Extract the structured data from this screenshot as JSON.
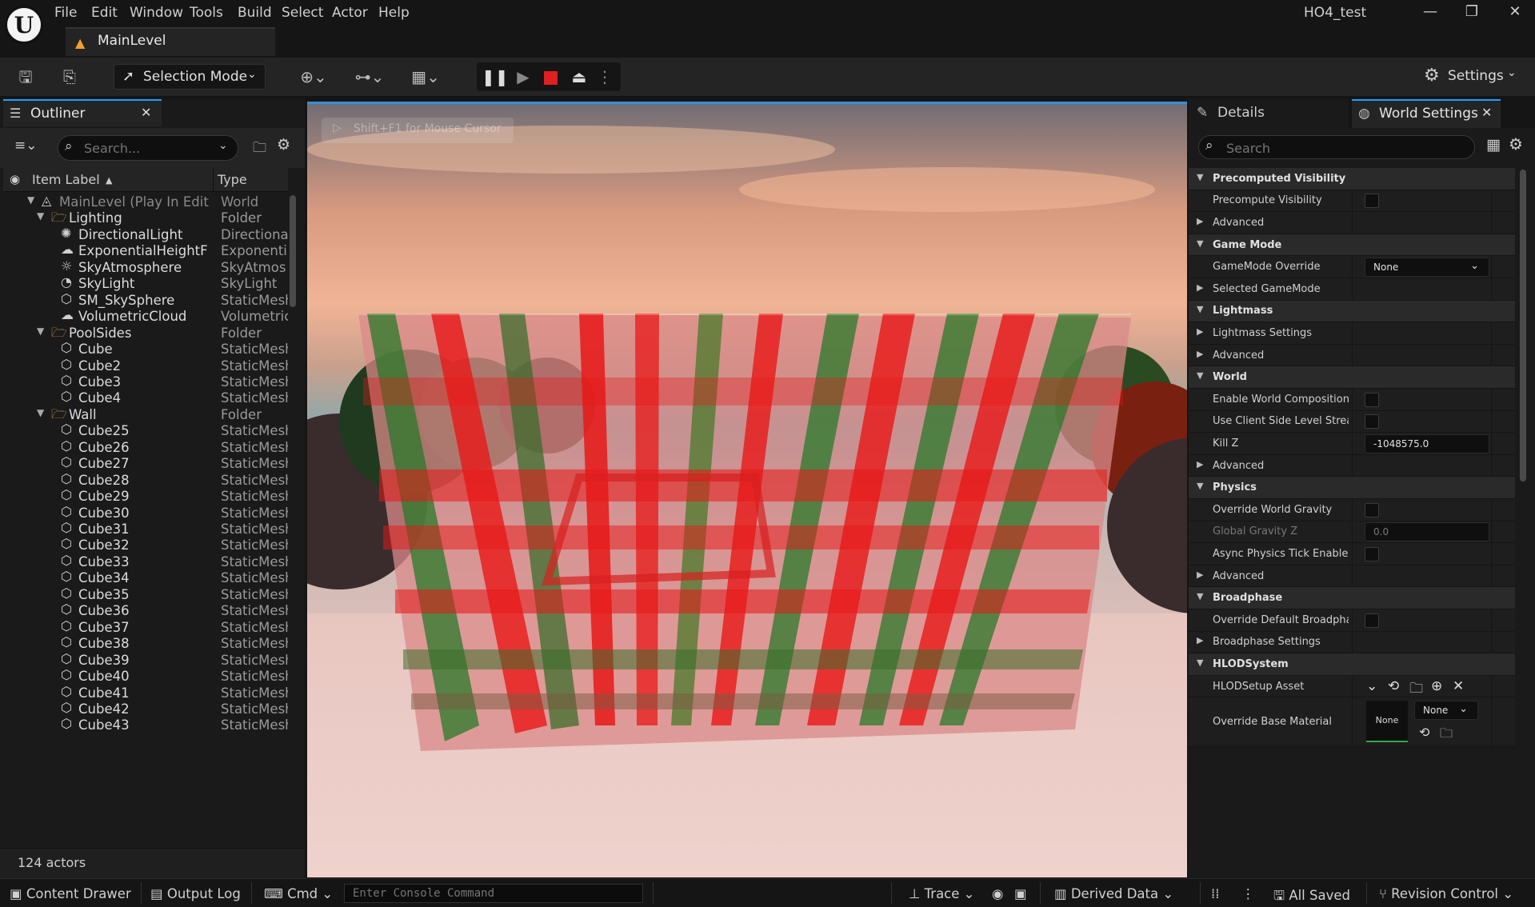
{
  "app": {
    "project_name": "HO4_test",
    "logo_glyph": "U"
  },
  "menu": [
    "File",
    "Edit",
    "Window",
    "Tools",
    "Build",
    "Select",
    "Actor",
    "Help"
  ],
  "document_tab": {
    "label": "MainLevel"
  },
  "window_controls": {
    "minimize": "—",
    "restore": "❐",
    "close": "✕"
  },
  "toolbar": {
    "mode_label": "Selection Mode",
    "settings_label": "Settings"
  },
  "outliner": {
    "tab_label": "Outliner",
    "search_placeholder": "Search...",
    "col_label": "Item Label",
    "col_type": "Type",
    "footer": "124 actors",
    "rows": [
      {
        "indent": 0,
        "arrow": "▼",
        "icon": "level",
        "label": "MainLevel (Play In Edit",
        "type": "World",
        "dim": true
      },
      {
        "indent": 1,
        "arrow": "▼",
        "icon": "folder",
        "label": "Lighting",
        "type": "Folder"
      },
      {
        "indent": 2,
        "icon": "light",
        "label": "DirectionalLight",
        "type": "Directional"
      },
      {
        "indent": 2,
        "icon": "fog",
        "label": "ExponentialHeightF",
        "type": "Exponentia"
      },
      {
        "indent": 2,
        "icon": "sky",
        "label": "SkyAtmosphere",
        "type": "SkyAtmos"
      },
      {
        "indent": 2,
        "icon": "skylight",
        "label": "SkyLight",
        "type": "SkyLight"
      },
      {
        "indent": 2,
        "icon": "mesh",
        "label": "SM_SkySphere",
        "type": "StaticMesh"
      },
      {
        "indent": 2,
        "icon": "cloud",
        "label": "VolumetricCloud",
        "type": "Volumetric"
      },
      {
        "indent": 1,
        "arrow": "▼",
        "icon": "folder",
        "label": "PoolSides",
        "type": "Folder"
      },
      {
        "indent": 2,
        "icon": "mesh",
        "label": "Cube",
        "type": "StaticMesh"
      },
      {
        "indent": 2,
        "icon": "mesh",
        "label": "Cube2",
        "type": "StaticMesh"
      },
      {
        "indent": 2,
        "icon": "mesh",
        "label": "Cube3",
        "type": "StaticMesh"
      },
      {
        "indent": 2,
        "icon": "mesh",
        "label": "Cube4",
        "type": "StaticMesh"
      },
      {
        "indent": 1,
        "arrow": "▼",
        "icon": "folder",
        "label": "Wall",
        "type": "Folder"
      },
      {
        "indent": 2,
        "icon": "mesh",
        "label": "Cube25",
        "type": "StaticMesh"
      },
      {
        "indent": 2,
        "icon": "mesh",
        "label": "Cube26",
        "type": "StaticMesh"
      },
      {
        "indent": 2,
        "icon": "mesh",
        "label": "Cube27",
        "type": "StaticMesh"
      },
      {
        "indent": 2,
        "icon": "mesh",
        "label": "Cube28",
        "type": "StaticMesh"
      },
      {
        "indent": 2,
        "icon": "mesh",
        "label": "Cube29",
        "type": "StaticMesh"
      },
      {
        "indent": 2,
        "icon": "mesh",
        "label": "Cube30",
        "type": "StaticMesh"
      },
      {
        "indent": 2,
        "icon": "mesh",
        "label": "Cube31",
        "type": "StaticMesh"
      },
      {
        "indent": 2,
        "icon": "mesh",
        "label": "Cube32",
        "type": "StaticMesh"
      },
      {
        "indent": 2,
        "icon": "mesh",
        "label": "Cube33",
        "type": "StaticMesh"
      },
      {
        "indent": 2,
        "icon": "mesh",
        "label": "Cube34",
        "type": "StaticMesh"
      },
      {
        "indent": 2,
        "icon": "mesh",
        "label": "Cube35",
        "type": "StaticMesh"
      },
      {
        "indent": 2,
        "icon": "mesh",
        "label": "Cube36",
        "type": "StaticMesh"
      },
      {
        "indent": 2,
        "icon": "mesh",
        "label": "Cube37",
        "type": "StaticMesh"
      },
      {
        "indent": 2,
        "icon": "mesh",
        "label": "Cube38",
        "type": "StaticMesh"
      },
      {
        "indent": 2,
        "icon": "mesh",
        "label": "Cube39",
        "type": "StaticMesh"
      },
      {
        "indent": 2,
        "icon": "mesh",
        "label": "Cube40",
        "type": "StaticMesh"
      },
      {
        "indent": 2,
        "icon": "mesh",
        "label": "Cube41",
        "type": "StaticMesh"
      },
      {
        "indent": 2,
        "icon": "mesh",
        "label": "Cube42",
        "type": "StaticMesh"
      },
      {
        "indent": 2,
        "icon": "mesh",
        "label": "Cube43",
        "type": "StaticMesh"
      }
    ]
  },
  "viewport": {
    "hint": "Shift+F1 for Mouse Cursor"
  },
  "details": {
    "tab_details": "Details",
    "tab_world_settings": "World Settings",
    "search_placeholder": "Search",
    "rows": [
      {
        "kind": "cat",
        "label": "Precomputed Visibility"
      },
      {
        "kind": "prop",
        "label": "Precompute Visibility",
        "value_type": "checkbox"
      },
      {
        "kind": "sub",
        "label": "Advanced"
      },
      {
        "kind": "cat",
        "label": "Game Mode"
      },
      {
        "kind": "prop",
        "label": "GameMode Override",
        "value_type": "combo",
        "value": "None"
      },
      {
        "kind": "sub",
        "label": "Selected GameMode"
      },
      {
        "kind": "cat",
        "label": "Lightmass"
      },
      {
        "kind": "sub",
        "label": "Lightmass Settings"
      },
      {
        "kind": "sub",
        "label": "Advanced"
      },
      {
        "kind": "cat",
        "label": "World"
      },
      {
        "kind": "prop",
        "label": "Enable World Composition",
        "value_type": "checkbox"
      },
      {
        "kind": "prop",
        "label": "Use Client Side Level Strea...",
        "value_type": "checkbox"
      },
      {
        "kind": "prop",
        "label": "Kill Z",
        "value_type": "field",
        "value": "-1048575.0"
      },
      {
        "kind": "sub",
        "label": "Advanced"
      },
      {
        "kind": "cat",
        "label": "Physics"
      },
      {
        "kind": "prop",
        "label": "Override World Gravity",
        "value_type": "checkbox"
      },
      {
        "kind": "prop",
        "label": "Global Gravity Z",
        "value_type": "field",
        "value": "0.0",
        "dim": true
      },
      {
        "kind": "prop",
        "label": "Async Physics Tick Enabled",
        "value_type": "checkbox"
      },
      {
        "kind": "sub",
        "label": "Advanced"
      },
      {
        "kind": "cat",
        "label": "Broadphase"
      },
      {
        "kind": "prop",
        "label": "Override Default Broadphas...",
        "value_type": "checkbox"
      },
      {
        "kind": "sub",
        "label": "Broadphase Settings"
      },
      {
        "kind": "cat",
        "label": "HLODSystem"
      },
      {
        "kind": "prop",
        "label": "HLODSetup Asset",
        "value_type": "asset"
      },
      {
        "kind": "prop",
        "label": "Override Base Material",
        "value_type": "material",
        "value": "None",
        "thumb": "None"
      }
    ]
  },
  "statusbar": {
    "content_drawer": "Content Drawer",
    "output_log": "Output Log",
    "cmd": "Cmd",
    "console_placeholder": "Enter Console Command",
    "trace": "Trace",
    "derived_data": "Derived Data",
    "all_saved": "All Saved",
    "revision_control": "Revision Control"
  },
  "colors": {
    "accent": "#1ea0ff",
    "stop": "#e02020",
    "folder": "#d6a85a"
  }
}
